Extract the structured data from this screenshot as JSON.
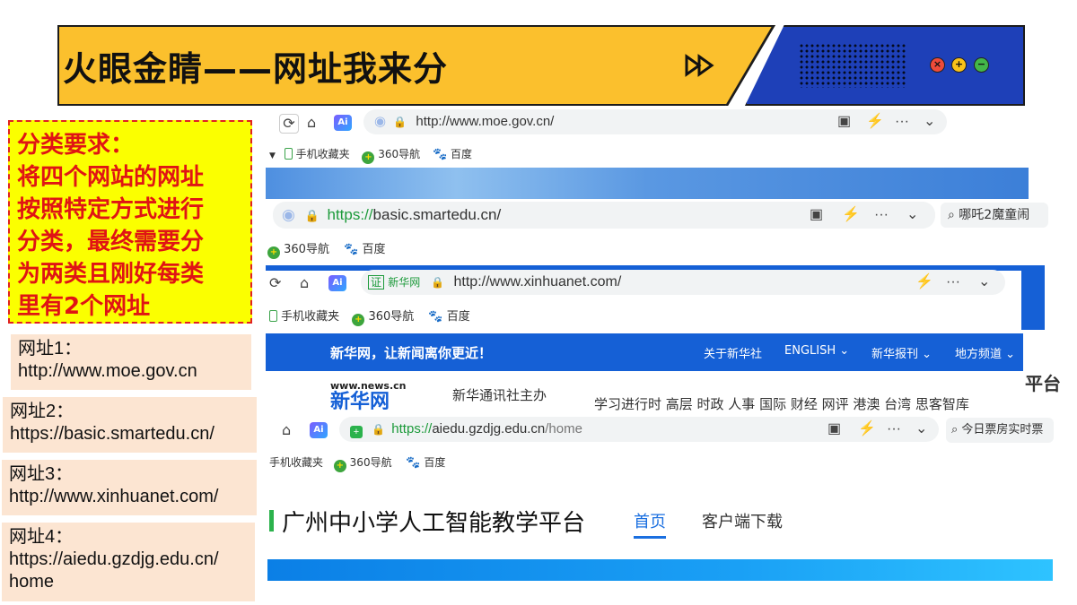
{
  "header": {
    "title": "火眼金睛——网址我来分",
    "arrow_glyph": "⏩",
    "window_buttons": {
      "close": "×",
      "max": "+",
      "min": "−"
    }
  },
  "requirement": {
    "lines": [
      "分类要求：",
      "将四个网站的网址",
      "按照特定方式进行",
      "分类，最终需要分",
      "为两类且刚好每类",
      "里有2个网址"
    ]
  },
  "urls": [
    {
      "label": "网址1：",
      "value": "http://www.moe.gov.cn"
    },
    {
      "label": "网址2：",
      "value": "https://basic.smartedu.cn/"
    },
    {
      "label": "网址3：",
      "value": "http://www.xinhuanet.com/"
    },
    {
      "label": "网址4：",
      "value": [
        "https://aiedu.gzdjg.edu.cn/",
        "home"
      ]
    }
  ],
  "browsers": {
    "moe": {
      "url": "http://www.moe.gov.cn/",
      "bookmarks": [
        "手机收藏夹",
        "360导航",
        "百度"
      ]
    },
    "smartedu": {
      "url_scheme": "https://",
      "url_rest": "basic.smartedu.cn/",
      "search_text": "哪吒2魔童闹",
      "bookmarks": [
        "360导航",
        "百度"
      ]
    },
    "xinhua": {
      "site_badge": "新华网",
      "url": "http://www.xinhuanet.com/",
      "bookmarks": [
        "手机收藏夹",
        "360导航",
        "百度"
      ],
      "slogan": "新华网，让新闻离你更近！",
      "nav": [
        "关于新华社",
        "ENGLISH ⌄",
        "新华报刊 ⌄",
        "地方频道 ⌄"
      ],
      "logo_small": "www.news.cn",
      "logo_big": "新华网",
      "sponsor": "新华通讯社主办",
      "sections": "学习进行时 高层 时政 人事 国际 财经 网评 港澳 台湾 思客智库",
      "edge_text": "平台"
    },
    "gzdjg": {
      "url_scheme": "https://",
      "url_host": "aiedu.gzdjg.edu.cn",
      "url_path": "/home",
      "search_text": "今日票房实时票",
      "bookmarks": [
        "手机收藏夹",
        "360导航",
        "百度"
      ],
      "site_title": "广州中小学人工智能教学平台",
      "nav": [
        "首页",
        "客户端下载"
      ]
    }
  },
  "colors": {
    "banner_yellow": "#fbc02d",
    "banner_blue": "#1e40b8",
    "req_text": "#e01414",
    "req_bg": "#fbff00",
    "card_bg": "#fce5d2",
    "xinhua_blue": "#1560d6"
  }
}
